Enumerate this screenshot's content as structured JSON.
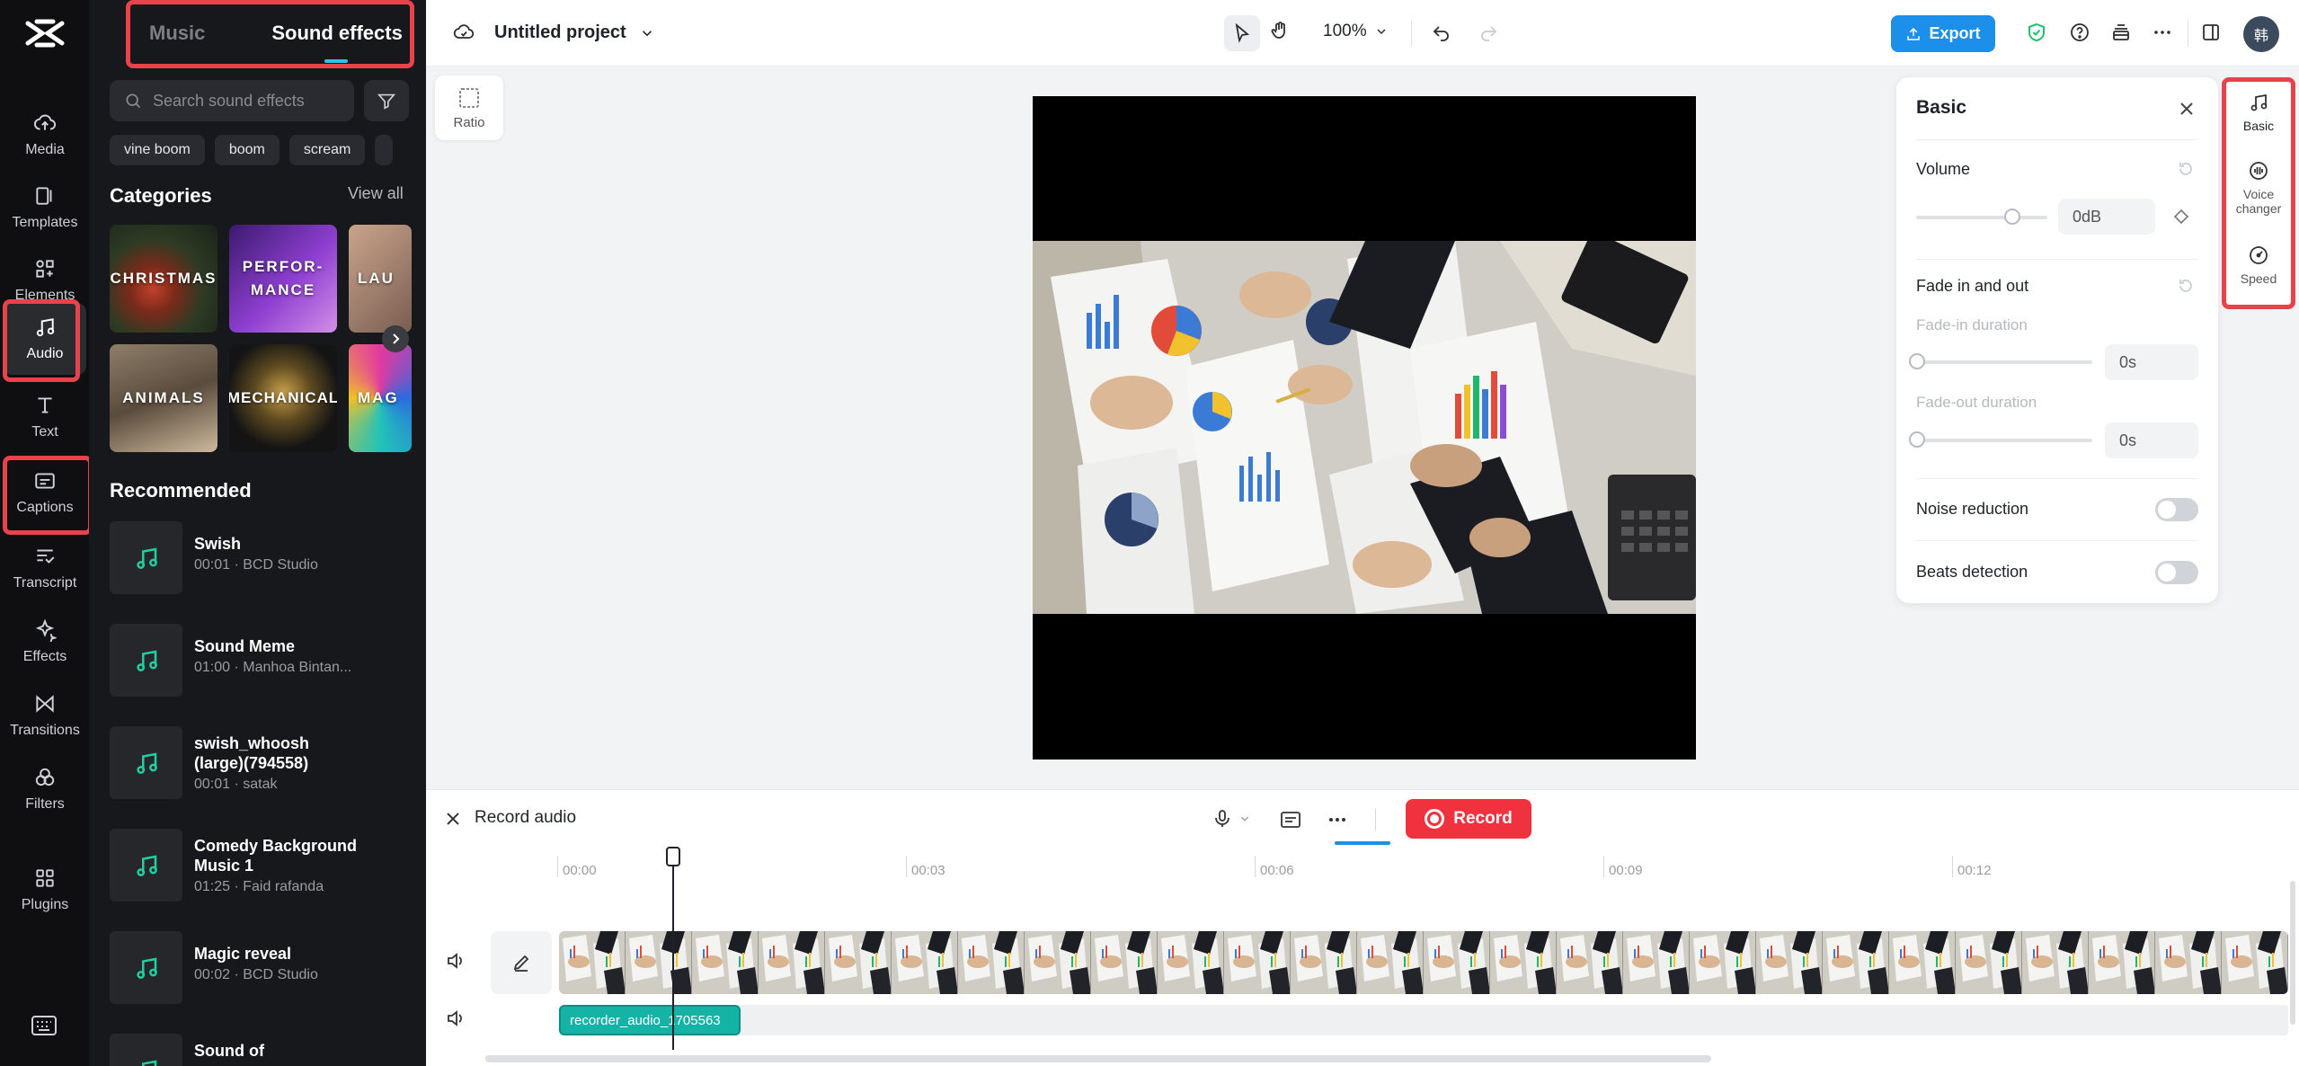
{
  "rail": {
    "items": [
      {
        "label": "Media",
        "icon": "cloud-upload-icon"
      },
      {
        "label": "Templates",
        "icon": "templates-icon"
      },
      {
        "label": "Elements",
        "icon": "elements-icon"
      },
      {
        "label": "Audio",
        "icon": "music-note-icon"
      },
      {
        "label": "Text",
        "icon": "text-icon"
      },
      {
        "label": "Captions",
        "icon": "captions-icon"
      },
      {
        "label": "Transcript",
        "icon": "transcript-icon"
      },
      {
        "label": "Effects",
        "icon": "effects-icon"
      },
      {
        "label": "Transitions",
        "icon": "transitions-icon"
      },
      {
        "label": "Filters",
        "icon": "filters-icon"
      },
      {
        "label": "Plugins",
        "icon": "plugins-icon"
      }
    ]
  },
  "panel": {
    "tabs": [
      "Music",
      "Sound effects"
    ],
    "search_placeholder": "Search sound effects",
    "chips": [
      "vine boom",
      "boom",
      "scream"
    ],
    "categories_title": "Categories",
    "view_all": "View all",
    "categories": [
      {
        "label": "CHRISTMAS"
      },
      {
        "label": "PERFOR-\nMANCE"
      },
      {
        "label": "LAU"
      },
      {
        "label": "ANIMALS"
      },
      {
        "label": "MECHANICAL"
      },
      {
        "label": "MAG"
      }
    ],
    "recommended_title": "Recommended",
    "tracks": [
      {
        "name": "Swish",
        "meta": "00:01 · BCD Studio"
      },
      {
        "name": "Sound Meme",
        "meta": "01:00 · Manhoa Bintan..."
      },
      {
        "name": "swish_whoosh (large)(794558)",
        "meta": "00:01 · satak"
      },
      {
        "name": "Comedy Background Music 1",
        "meta": "01:25 · Faid rafanda"
      },
      {
        "name": "Magic reveal",
        "meta": "00:02 · BCD Studio"
      },
      {
        "name": "Sound of",
        "meta": ""
      }
    ]
  },
  "topbar": {
    "project_title": "Untitled project",
    "zoom": "100%",
    "export_label": "Export",
    "avatar_text": "韩"
  },
  "canvas": {
    "ratio_label": "Ratio"
  },
  "basic": {
    "title": "Basic",
    "volume_label": "Volume",
    "volume_value": "0dB",
    "fade_label": "Fade in and out",
    "fade_in_label": "Fade-in duration",
    "fade_in_value": "0s",
    "fade_out_label": "Fade-out duration",
    "fade_out_value": "0s",
    "noise_label": "Noise reduction",
    "beats_label": "Beats detection"
  },
  "right_tabs": [
    "Basic",
    "Voice changer",
    "Speed"
  ],
  "record": {
    "title": "Record audio",
    "record_label": "Record"
  },
  "timeline": {
    "ticks": [
      "00:00",
      "00:03",
      "00:06",
      "00:09",
      "00:12"
    ],
    "audio_clip": "recorder_audio_1705563"
  }
}
